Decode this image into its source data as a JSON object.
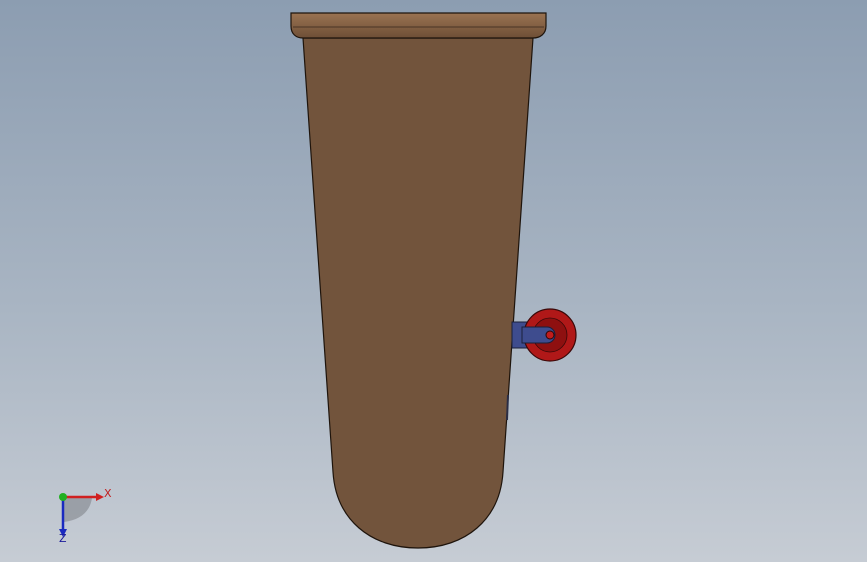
{
  "viewport": {
    "background_top": "#8c9db1",
    "background_bottom": "#c6ccd4"
  },
  "model": {
    "parts": [
      {
        "name": "cup-body",
        "color": "#72543c"
      },
      {
        "name": "rim",
        "color": "#8a6546"
      },
      {
        "name": "bracket",
        "color": "#3e4c8e"
      },
      {
        "name": "wheel",
        "color": "#b01818"
      }
    ]
  },
  "triad": {
    "x_label": "X",
    "z_label": "Z",
    "x_color": "#d02020",
    "y_color": "#20b020",
    "z_color": "#1a2ac0"
  }
}
